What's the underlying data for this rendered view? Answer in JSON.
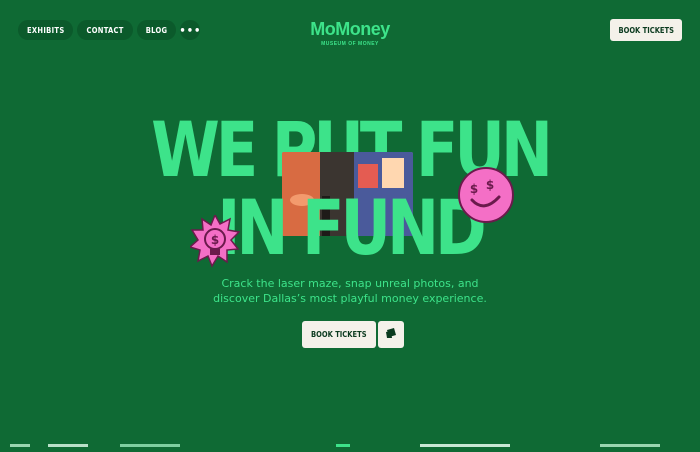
{
  "nav": {
    "items": [
      "EXHIBITS",
      "CONTACT",
      "BLOG"
    ],
    "more": "•••"
  },
  "logo": {
    "word": "MoMoney",
    "subtitle": "MUSEUM OF MONEY"
  },
  "header": {
    "book_tickets": "BOOK TICKETS"
  },
  "hero": {
    "line1": "WE PUT FUN",
    "line2": "IN FUND",
    "tagline_1": "Crack the laser maze, snap unreal photos, and",
    "tagline_2": "discover Dallas’s most playful money experience.",
    "cta_label": "BOOK TICKETS"
  },
  "icons": {
    "menu": "more-dots-icon",
    "ticket": "ticket-icon",
    "smiley": "dollar-eyes-smiley-icon",
    "bulb": "dollar-lightbulb-icon"
  },
  "colors": {
    "background": "#0f6a34",
    "accent_green": "#3de38a",
    "pill_bg": "#0b5a2b",
    "button_bg": "#f4f1ea",
    "pink": "#f46fc6"
  }
}
